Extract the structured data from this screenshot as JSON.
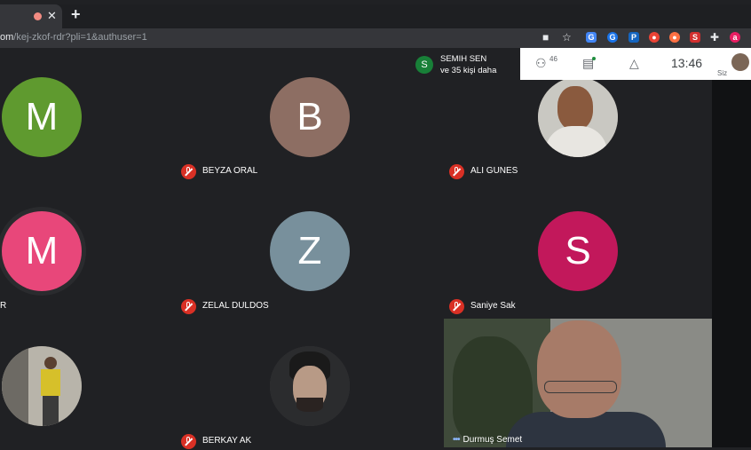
{
  "browser": {
    "url_host": "om",
    "url_path": "/kej-zkof-rdr?pli=1&authuser=1",
    "tab_close": "✕",
    "new_tab": "+"
  },
  "presenter": {
    "initial": "S",
    "name": "SEMIH SEN",
    "others": "ve 35 kişi daha"
  },
  "infobar": {
    "participant_count": "46",
    "time": "13:46",
    "self_label": "Siz"
  },
  "participants": [
    {
      "initial": "M",
      "color": "#5f9a2f",
      "name": ""
    },
    {
      "initial": "B",
      "color": "#8d6e63",
      "name": "BEYZA ORAL"
    },
    {
      "initial": "",
      "color": "#7a7266",
      "name": "ALI GUNES"
    },
    {
      "initial": "M",
      "color": "#e8477a",
      "name": "R"
    },
    {
      "initial": "Z",
      "color": "#78909c",
      "name": "ZELAL DULDOS"
    },
    {
      "initial": "S",
      "color": "#c2185b",
      "name": "Saniye Sak"
    },
    {
      "initial": "",
      "color": "#6b6a64",
      "name": ""
    },
    {
      "initial": "",
      "color": "#3d3e41",
      "name": "BERKAY AK"
    }
  ],
  "video": {
    "name": "Durmuş Semet"
  }
}
